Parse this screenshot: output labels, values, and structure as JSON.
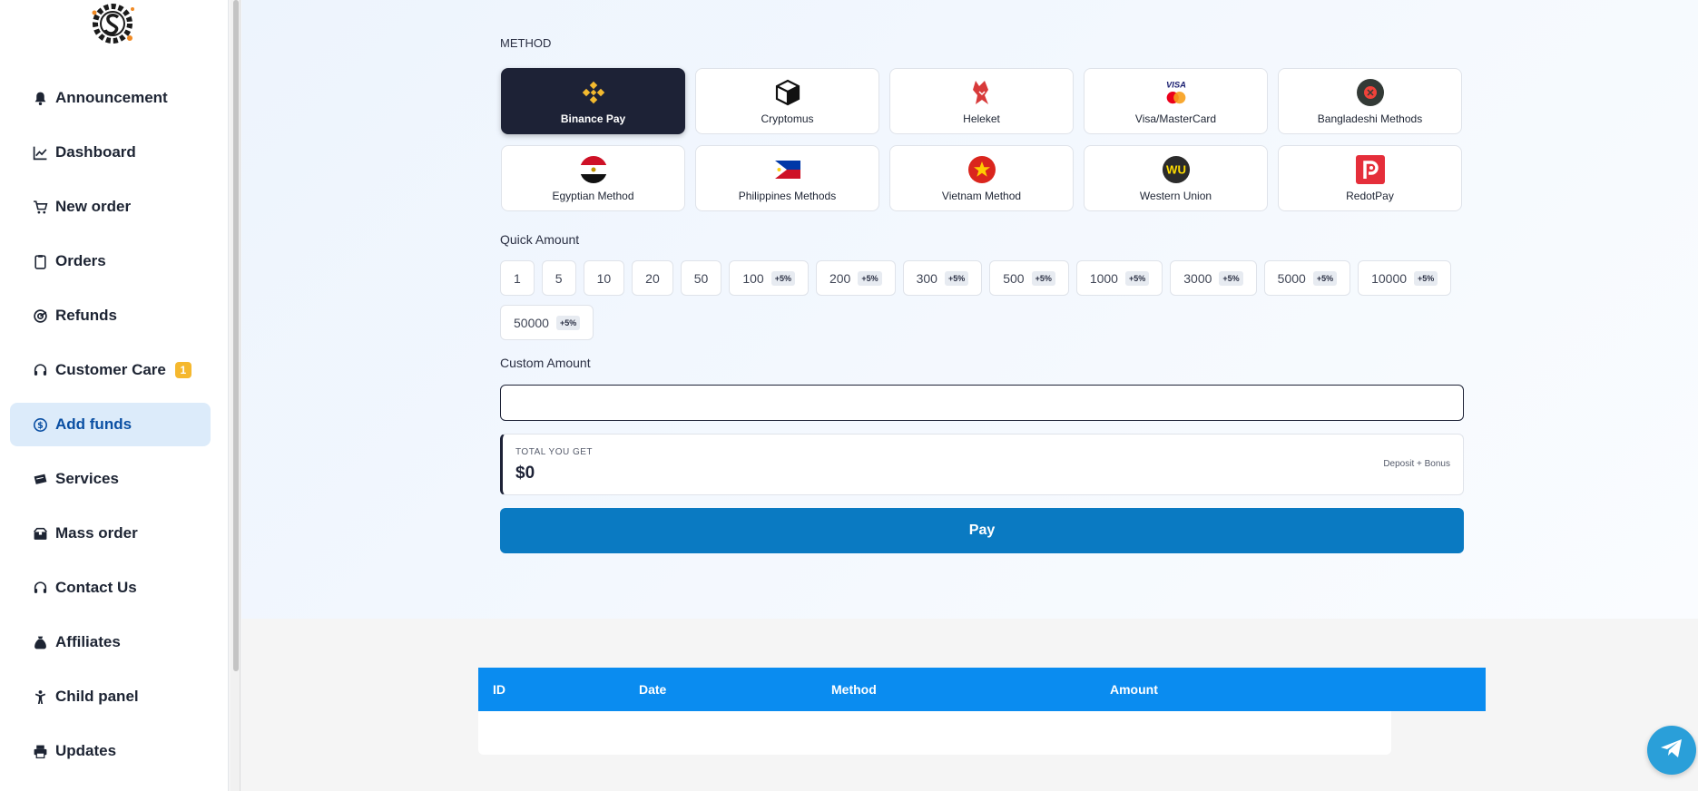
{
  "sidebar": {
    "items": [
      {
        "label": "Announcement",
        "icon": "bell-icon"
      },
      {
        "label": "Dashboard",
        "icon": "chart-line-icon"
      },
      {
        "label": "New order",
        "icon": "cart-icon"
      },
      {
        "label": "Orders",
        "icon": "clipboard-icon"
      },
      {
        "label": "Refunds",
        "icon": "refund-icon"
      },
      {
        "label": "Customer Care",
        "icon": "headset-icon",
        "badge": "1"
      },
      {
        "label": "Add funds",
        "icon": "dollar-circle-icon",
        "active": true
      },
      {
        "label": "Services",
        "icon": "ticket-icon"
      },
      {
        "label": "Mass order",
        "icon": "boxes-icon"
      },
      {
        "label": "Contact Us",
        "icon": "headset-icon"
      },
      {
        "label": "Affiliates",
        "icon": "money-bag-icon"
      },
      {
        "label": "Child panel",
        "icon": "child-icon"
      },
      {
        "label": "Updates",
        "icon": "printer-icon"
      }
    ]
  },
  "main": {
    "method_label": "METHOD",
    "methods": [
      {
        "label": "Binance Pay",
        "icon": "binance-icon",
        "selected": true
      },
      {
        "label": "Cryptomus",
        "icon": "cube-icon"
      },
      {
        "label": "Heleket",
        "icon": "heleket-icon"
      },
      {
        "label": "Visa/MasterCard",
        "icon": "visa-mastercard-icon"
      },
      {
        "label": "Bangladeshi Methods",
        "icon": "bangladesh-icon"
      },
      {
        "label": "Egyptian Method",
        "icon": "egypt-flag-icon"
      },
      {
        "label": "Philippines Methods",
        "icon": "philippines-flag-icon"
      },
      {
        "label": "Vietnam Method",
        "icon": "vietnam-flag-icon"
      },
      {
        "label": "Western Union",
        "icon": "western-union-icon"
      },
      {
        "label": "RedotPay",
        "icon": "redotpay-icon"
      }
    ],
    "quick_amount_label": "Quick Amount",
    "amounts": [
      {
        "value": "1",
        "bonus": ""
      },
      {
        "value": "5",
        "bonus": ""
      },
      {
        "value": "10",
        "bonus": ""
      },
      {
        "value": "20",
        "bonus": ""
      },
      {
        "value": "50",
        "bonus": ""
      },
      {
        "value": "100",
        "bonus": "+5%"
      },
      {
        "value": "200",
        "bonus": "+5%"
      },
      {
        "value": "300",
        "bonus": "+5%"
      },
      {
        "value": "500",
        "bonus": "+5%"
      },
      {
        "value": "1000",
        "bonus": "+5%"
      },
      {
        "value": "3000",
        "bonus": "+5%"
      },
      {
        "value": "5000",
        "bonus": "+5%"
      },
      {
        "value": "10000",
        "bonus": "+5%"
      },
      {
        "value": "50000",
        "bonus": "+5%"
      }
    ],
    "custom_amount_label": "Custom Amount",
    "custom_amount_value": "",
    "total_label": "TOTAL YOU GET",
    "total_value": "$0",
    "total_note": "Deposit + Bonus",
    "pay_label": "Pay"
  },
  "table": {
    "columns": [
      "ID",
      "Date",
      "Method",
      "Amount"
    ]
  },
  "colors": {
    "accent": "#0a7ac2",
    "selected_method_bg": "#1d2236",
    "table_header": "#0a8cf0",
    "active_nav_bg": "#dcebfa",
    "badge": "#f5b82e"
  }
}
